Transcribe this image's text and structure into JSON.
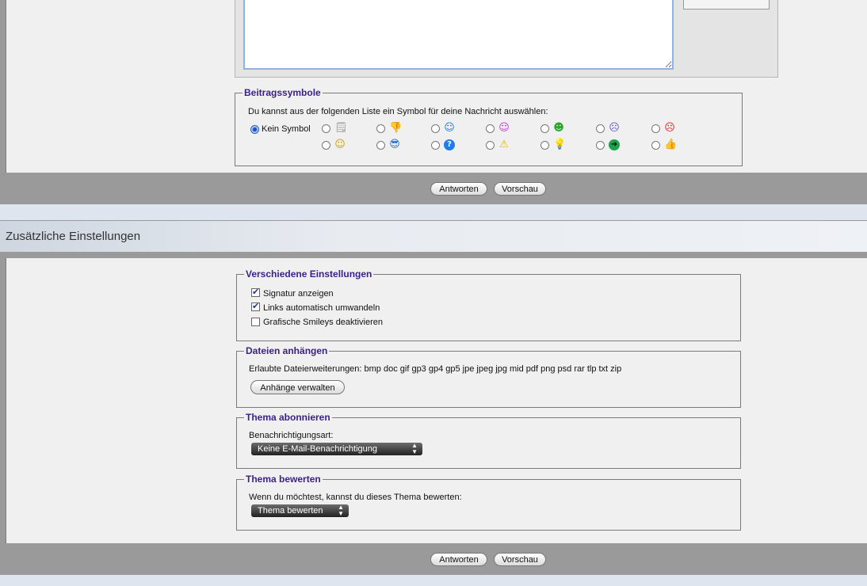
{
  "editor": {},
  "post_icons": {
    "legend": "Beitragssymbole",
    "description": "Du kannst aus der folgenden Liste ein Symbol für deine Nachricht auswählen:",
    "no_icon_label": "Kein Symbol",
    "icons_row1": [
      "document-icon",
      "thumbs-down-icon",
      "wink-icon",
      "tongue-icon",
      "grin-icon",
      "sad-icon",
      "angry-icon"
    ],
    "icons_row2": [
      "smile-icon",
      "cool-icon",
      "question-icon",
      "warning-icon",
      "lightbulb-icon",
      "arrow-right-icon",
      "thumbs-up-icon"
    ]
  },
  "buttons_top": {
    "reply": "Antworten",
    "preview": "Vorschau"
  },
  "extra_settings": {
    "title": "Zusätzliche Einstellungen"
  },
  "misc": {
    "legend": "Verschiedene Einstellungen",
    "options": [
      {
        "label": "Signatur anzeigen",
        "checked": true
      },
      {
        "label": "Links automatisch umwandeln",
        "checked": true
      },
      {
        "label": "Grafische Smileys deaktivieren",
        "checked": false
      }
    ]
  },
  "attachments": {
    "legend": "Dateien anhängen",
    "allowed": "Erlaubte Dateierweiterungen: bmp doc gif gp3 gp4 gp5 jpe jpeg jpg mid pdf png psd rar tlp txt zip",
    "manage_button": "Anhänge verwalten"
  },
  "subscribe": {
    "legend": "Thema abonnieren",
    "label": "Benachrichtigungsart:",
    "selected": "Keine E-Mail-Benachrichtigung"
  },
  "rate": {
    "legend": "Thema bewerten",
    "label": "Wenn du möchtest, kannst du dieses Thema bewerten:",
    "selected": "Thema bewerten"
  },
  "buttons_bottom": {
    "reply": "Antworten",
    "preview": "Vorschau"
  },
  "colors": {
    "legend": "#3a1f8a",
    "panel": "#f0f0f0",
    "frame": "#9a9a9a",
    "header_band": "#e3e8ef"
  }
}
